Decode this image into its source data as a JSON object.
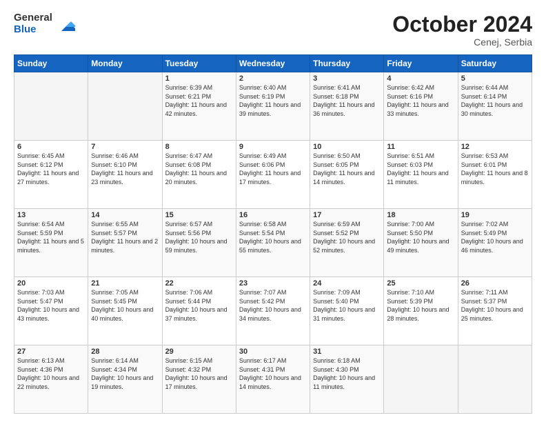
{
  "header": {
    "logo_general": "General",
    "logo_blue": "Blue",
    "month_title": "October 2024",
    "location": "Cenej, Serbia"
  },
  "weekdays": [
    "Sunday",
    "Monday",
    "Tuesday",
    "Wednesday",
    "Thursday",
    "Friday",
    "Saturday"
  ],
  "weeks": [
    [
      {
        "day": "",
        "empty": true
      },
      {
        "day": "",
        "empty": true
      },
      {
        "day": "1",
        "sunrise": "6:39 AM",
        "sunset": "6:21 PM",
        "daylight": "11 hours and 42 minutes."
      },
      {
        "day": "2",
        "sunrise": "6:40 AM",
        "sunset": "6:19 PM",
        "daylight": "11 hours and 39 minutes."
      },
      {
        "day": "3",
        "sunrise": "6:41 AM",
        "sunset": "6:18 PM",
        "daylight": "11 hours and 36 minutes."
      },
      {
        "day": "4",
        "sunrise": "6:42 AM",
        "sunset": "6:16 PM",
        "daylight": "11 hours and 33 minutes."
      },
      {
        "day": "5",
        "sunrise": "6:44 AM",
        "sunset": "6:14 PM",
        "daylight": "11 hours and 30 minutes."
      }
    ],
    [
      {
        "day": "6",
        "sunrise": "6:45 AM",
        "sunset": "6:12 PM",
        "daylight": "11 hours and 27 minutes."
      },
      {
        "day": "7",
        "sunrise": "6:46 AM",
        "sunset": "6:10 PM",
        "daylight": "11 hours and 23 minutes."
      },
      {
        "day": "8",
        "sunrise": "6:47 AM",
        "sunset": "6:08 PM",
        "daylight": "11 hours and 20 minutes."
      },
      {
        "day": "9",
        "sunrise": "6:49 AM",
        "sunset": "6:06 PM",
        "daylight": "11 hours and 17 minutes."
      },
      {
        "day": "10",
        "sunrise": "6:50 AM",
        "sunset": "6:05 PM",
        "daylight": "11 hours and 14 minutes."
      },
      {
        "day": "11",
        "sunrise": "6:51 AM",
        "sunset": "6:03 PM",
        "daylight": "11 hours and 11 minutes."
      },
      {
        "day": "12",
        "sunrise": "6:53 AM",
        "sunset": "6:01 PM",
        "daylight": "11 hours and 8 minutes."
      }
    ],
    [
      {
        "day": "13",
        "sunrise": "6:54 AM",
        "sunset": "5:59 PM",
        "daylight": "11 hours and 5 minutes."
      },
      {
        "day": "14",
        "sunrise": "6:55 AM",
        "sunset": "5:57 PM",
        "daylight": "11 hours and 2 minutes."
      },
      {
        "day": "15",
        "sunrise": "6:57 AM",
        "sunset": "5:56 PM",
        "daylight": "10 hours and 59 minutes."
      },
      {
        "day": "16",
        "sunrise": "6:58 AM",
        "sunset": "5:54 PM",
        "daylight": "10 hours and 55 minutes."
      },
      {
        "day": "17",
        "sunrise": "6:59 AM",
        "sunset": "5:52 PM",
        "daylight": "10 hours and 52 minutes."
      },
      {
        "day": "18",
        "sunrise": "7:00 AM",
        "sunset": "5:50 PM",
        "daylight": "10 hours and 49 minutes."
      },
      {
        "day": "19",
        "sunrise": "7:02 AM",
        "sunset": "5:49 PM",
        "daylight": "10 hours and 46 minutes."
      }
    ],
    [
      {
        "day": "20",
        "sunrise": "7:03 AM",
        "sunset": "5:47 PM",
        "daylight": "10 hours and 43 minutes."
      },
      {
        "day": "21",
        "sunrise": "7:05 AM",
        "sunset": "5:45 PM",
        "daylight": "10 hours and 40 minutes."
      },
      {
        "day": "22",
        "sunrise": "7:06 AM",
        "sunset": "5:44 PM",
        "daylight": "10 hours and 37 minutes."
      },
      {
        "day": "23",
        "sunrise": "7:07 AM",
        "sunset": "5:42 PM",
        "daylight": "10 hours and 34 minutes."
      },
      {
        "day": "24",
        "sunrise": "7:09 AM",
        "sunset": "5:40 PM",
        "daylight": "10 hours and 31 minutes."
      },
      {
        "day": "25",
        "sunrise": "7:10 AM",
        "sunset": "5:39 PM",
        "daylight": "10 hours and 28 minutes."
      },
      {
        "day": "26",
        "sunrise": "7:11 AM",
        "sunset": "5:37 PM",
        "daylight": "10 hours and 25 minutes."
      }
    ],
    [
      {
        "day": "27",
        "sunrise": "6:13 AM",
        "sunset": "4:36 PM",
        "daylight": "10 hours and 22 minutes."
      },
      {
        "day": "28",
        "sunrise": "6:14 AM",
        "sunset": "4:34 PM",
        "daylight": "10 hours and 19 minutes."
      },
      {
        "day": "29",
        "sunrise": "6:15 AM",
        "sunset": "4:32 PM",
        "daylight": "10 hours and 17 minutes."
      },
      {
        "day": "30",
        "sunrise": "6:17 AM",
        "sunset": "4:31 PM",
        "daylight": "10 hours and 14 minutes."
      },
      {
        "day": "31",
        "sunrise": "6:18 AM",
        "sunset": "4:30 PM",
        "daylight": "10 hours and 11 minutes."
      },
      {
        "day": "",
        "empty": true
      },
      {
        "day": "",
        "empty": true
      }
    ]
  ],
  "labels": {
    "sunrise_prefix": "Sunrise: ",
    "sunset_prefix": "Sunset: ",
    "daylight_prefix": "Daylight: "
  }
}
